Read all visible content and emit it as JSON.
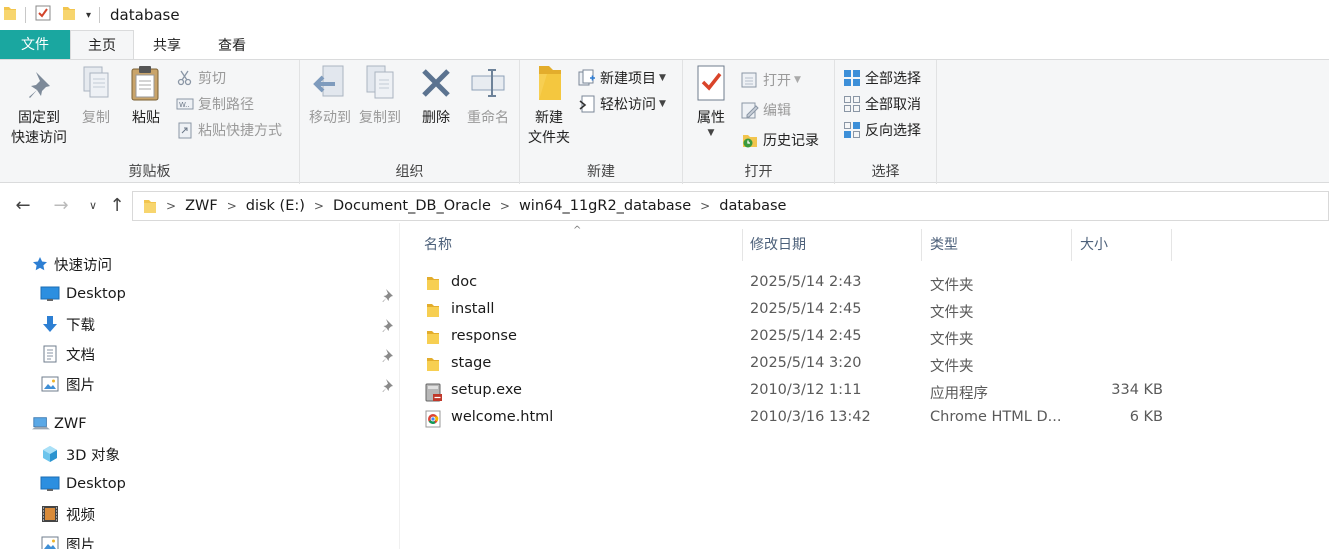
{
  "window": {
    "title": "database"
  },
  "ribbon_tabs": {
    "file": "文件",
    "home": "主页",
    "share": "共享",
    "view": "查看"
  },
  "clipboard": {
    "pin_line1": "固定到",
    "pin_line2": "快速访问",
    "copy": "复制",
    "paste": "粘贴",
    "cut": "剪切",
    "copy_path": "复制路径",
    "paste_shortcut": "粘贴快捷方式",
    "label": "剪贴板"
  },
  "organize": {
    "move_to": "移动到",
    "copy_to": "复制到",
    "delete": "删除",
    "rename": "重命名",
    "label": "组织"
  },
  "new_group": {
    "new_folder_line1": "新建",
    "new_folder_line2": "文件夹",
    "new_item": "新建项目",
    "easy_access": "轻松访问",
    "label": "新建"
  },
  "open_group": {
    "properties": "属性",
    "open": "打开",
    "edit": "编辑",
    "history": "历史记录",
    "label": "打开"
  },
  "select_group": {
    "select_all": "全部选择",
    "select_none": "全部取消",
    "invert": "反向选择",
    "label": "选择"
  },
  "breadcrumb": [
    "ZWF",
    "disk (E:)",
    "Document_DB_Oracle",
    "win64_11gR2_database",
    "database"
  ],
  "nav": {
    "quick_access": "快速访问",
    "qa_items": [
      "Desktop",
      "下载",
      "文档",
      "图片"
    ],
    "this_pc": "ZWF",
    "pc_items": [
      "3D 对象",
      "Desktop",
      "视频",
      "图片"
    ]
  },
  "columns": {
    "name": "名称",
    "date": "修改日期",
    "type": "类型",
    "size": "大小"
  },
  "files": [
    {
      "name": "doc",
      "date": "2025/5/14 2:43",
      "type": "文件夹",
      "size": "",
      "icon": "folder-icon"
    },
    {
      "name": "install",
      "date": "2025/5/14 2:45",
      "type": "文件夹",
      "size": "",
      "icon": "folder-icon"
    },
    {
      "name": "response",
      "date": "2025/5/14 2:45",
      "type": "文件夹",
      "size": "",
      "icon": "folder-icon"
    },
    {
      "name": "stage",
      "date": "2025/5/14 3:20",
      "type": "文件夹",
      "size": "",
      "icon": "folder-icon"
    },
    {
      "name": "setup.exe",
      "date": "2010/3/12 1:11",
      "type": "应用程序",
      "size": "334 KB",
      "icon": "exe-icon"
    },
    {
      "name": "welcome.html",
      "date": "2010/3/16 13:42",
      "type": "Chrome HTML D...",
      "size": "6 KB",
      "icon": "chrome-html-icon"
    }
  ],
  "colors": {
    "file_tab": "#1aa7a0",
    "ribbon_bg": "#f5f6f7",
    "folder": "#f2c54e",
    "column_header": "#4c607a"
  }
}
